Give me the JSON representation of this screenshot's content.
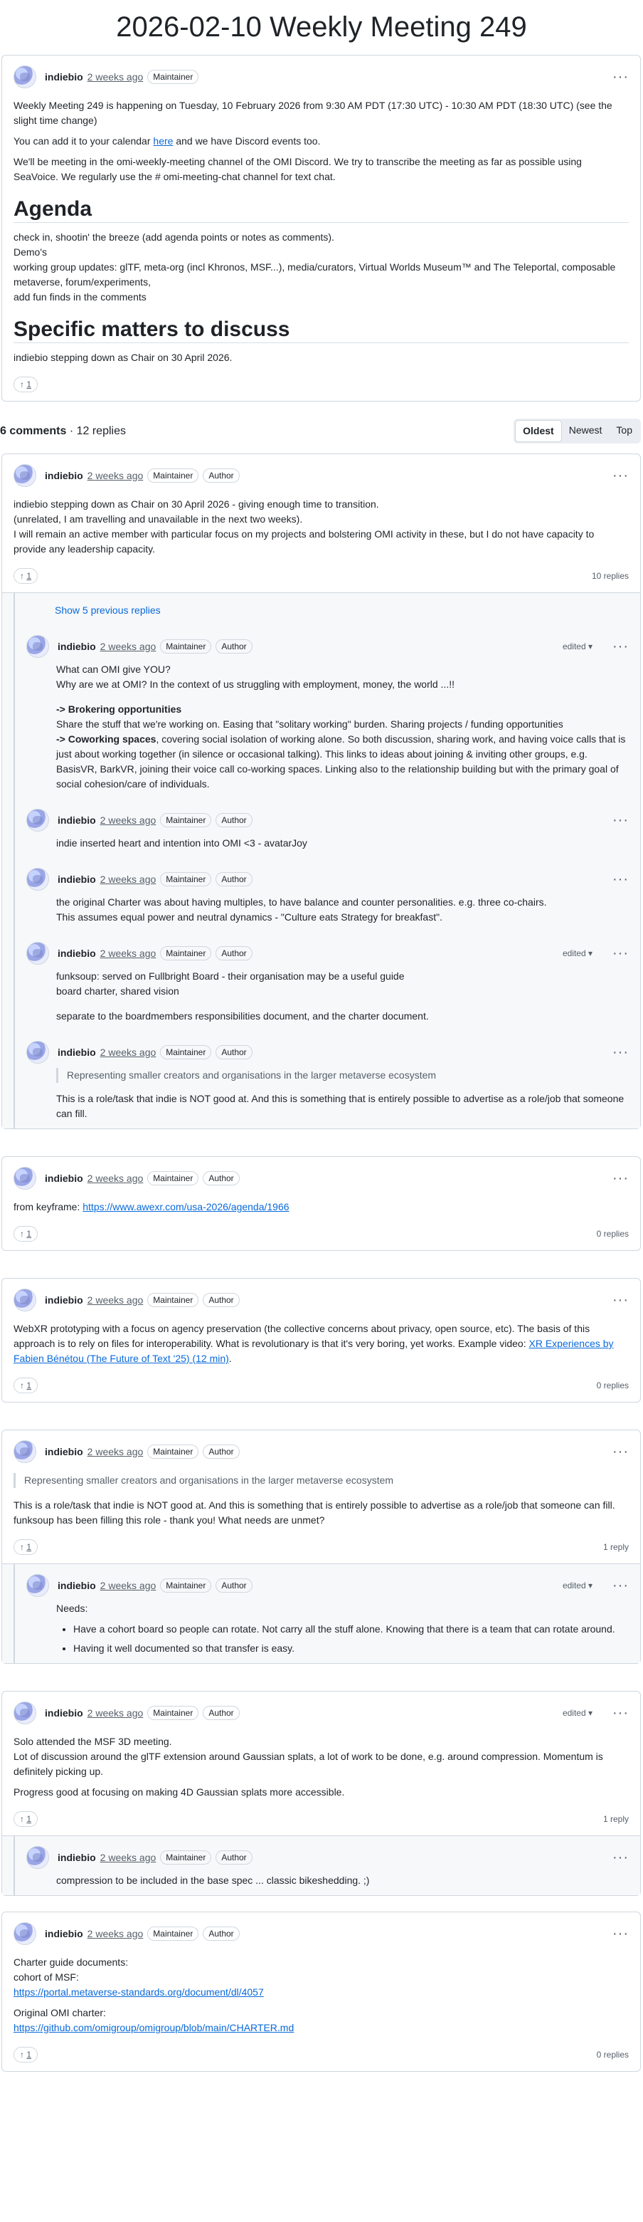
{
  "title": "2026-02-10 Weekly Meeting 249",
  "labels": {
    "maintainer": "Maintainer",
    "author": "Author",
    "edited": "edited",
    "show_previous": "Show 5 previous replies"
  },
  "discussion": {
    "author": "indiebio",
    "time": "2 weeks ago",
    "p1": "Weekly Meeting 249 is happening on Tuesday, 10 February 2026 from 9:30 AM PDT (17:30 UTC) - 10:30 AM PDT (18:30 UTC) (see the slight time change)",
    "p2_pre": "You can add it to your calendar ",
    "p2_link": "here",
    "p2_post": " and we have Discord events too.",
    "p3": "We'll be meeting in the omi-weekly-meeting channel of the OMI Discord. We try to transcribe the meeting as far as possible using SeaVoice. We regularly use the # omi-meeting-chat channel for text chat.",
    "agenda_heading": "Agenda",
    "agenda_lines": [
      "check in, shootin' the breeze (add agenda points or notes as comments).",
      "Demo's",
      "working group updates: glTF, meta-org (incl Khronos, MSF...), media/curators, Virtual Worlds Museum™ and The Teleportal, composable metaverse, forum/experiments,",
      "add fun finds in the comments"
    ],
    "specific_heading": "Specific matters to discuss",
    "specific_text": "indiebio stepping down as Chair on 30 April 2026.",
    "reactions": "1"
  },
  "summary": {
    "comments": "6 comments",
    "replies": " · 12 replies"
  },
  "sort": [
    "Oldest",
    "Newest",
    "Top"
  ],
  "comments": [
    {
      "lines": [
        "indiebio stepping down as Chair on 30 April 2026 - giving enough time to transition.",
        "(unrelated, I am travelling and unavailable in the next two weeks).",
        "I will remain an active member with particular focus on my projects and bolstering OMI activity in these, but I do not have capacity to provide any leadership capacity."
      ],
      "reactions": "1",
      "replies_count": "10 replies"
    },
    {
      "text": "from keyframe: ",
      "link": "https://www.awexr.com/usa-2026/agenda/1966",
      "reactions": "1",
      "replies_count": "0 replies"
    },
    {
      "text": "WebXR prototyping with a focus on agency preservation (the collective concerns about privacy, open source, etc). The basis of this approach is to rely on files for interoperability. What is revolutionary is that it's very boring, yet works. Example video: ",
      "link": "XR Experiences by Fabien Bénétou (The Future of Text '25) (12 min)",
      "tail": ".",
      "reactions": "1",
      "replies_count": "0 replies"
    },
    {
      "quote": "Representing smaller creators and organisations in the larger metaverse ecosystem",
      "lines": [
        "This is a role/task that indie is NOT good at. And this is something that is entirely possible to advertise as a role/job that someone can fill.",
        "funksoup has been filling this role - thank you! What needs are unmet?"
      ],
      "reactions": "1",
      "replies_count": "1 reply"
    },
    {
      "lines": [
        "Solo attended the MSF 3D meeting.",
        "Lot of discussion around the glTF extension around Gaussian splats, a lot of work to be done, e.g. around compression. Momentum is definitely picking up."
      ],
      "p2": "Progress good at focusing on making 4D Gaussian splats more accessible.",
      "reactions": "1",
      "replies_count": "1 reply"
    },
    {
      "l1": "Charter guide documents:",
      "l2": "cohort of MSF:",
      "link1": "https://portal.metaverse-standards.org/document/dl/4057",
      "l3": "Original OMI charter:",
      "link2": "https://github.com/omigroup/omigroup/blob/main/CHARTER.md",
      "reactions": "1",
      "replies_count": "0 replies"
    }
  ],
  "replies1": [
    {
      "l1": "What can OMI give YOU?",
      "l2": "Why are we at OMI? In the context of us struggling with employment, money, the world ...!!",
      "b1": "-> Brokering opportunities",
      "l3": "Share the stuff that we're working on. Easing that \"solitary working\" burden. Sharing projects / funding opportunities",
      "b2": "-> Coworking spaces",
      "l4": ", covering social isolation of working alone. So both discussion, sharing work, and having voice calls that is just about working together (in silence or occasional talking). This links to ideas about joining & inviting other groups, e.g. BasisVR, BarkVR, joining their voice call co-working spaces. Linking also to the relationship building but with the primary goal of social cohesion/care of individuals."
    },
    {
      "l1": "indie inserted heart and intention into OMI <3 - avatarJoy"
    },
    {
      "l1": "the original Charter was about having multiples, to have balance and counter personalities. e.g. three co-chairs.",
      "l2": "This assumes equal power and neutral dynamics - \"Culture eats Strategy for breakfast\"."
    },
    {
      "l1": "funksoup: served on Fullbright Board - their organisation may be a useful guide",
      "l2": "board charter, shared vision",
      "p2": "separate to the boardmembers responsibilities document, and the charter document."
    },
    {
      "quote": "Representing smaller creators and organisations in the larger metaverse ecosystem",
      "p": "This is a role/task that indie is NOT good at. And this is something that is entirely possible to advertise as a role/job that someone can fill."
    }
  ],
  "reply4": {
    "needs": "Needs:",
    "items": [
      "Have a cohort board so people can rotate. Not carry all the stuff alone. Knowing that there is a team that can rotate around.",
      "Having it well documented so that transfer is easy."
    ]
  },
  "reply5": {
    "text": "compression to be included in the base spec ... classic bikeshedding. ;)"
  },
  "icons": {
    "upvote": "arrow-up-icon",
    "more": "kebab-icon",
    "caret": "caret-down-icon"
  }
}
